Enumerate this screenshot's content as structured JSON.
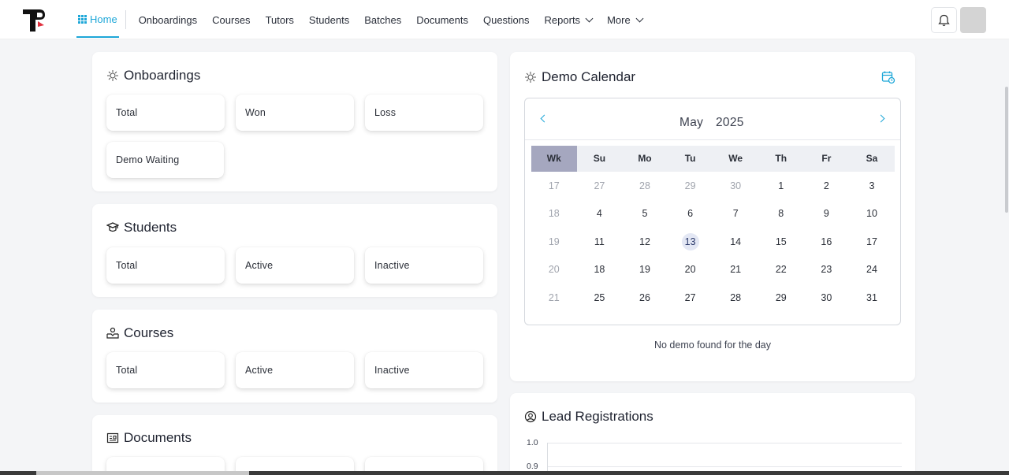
{
  "nav": {
    "home": "Home",
    "items": [
      "Onboardings",
      "Courses",
      "Tutors",
      "Students",
      "Batches",
      "Documents",
      "Questions"
    ],
    "reports": "Reports",
    "more": "More"
  },
  "onboardings": {
    "title": "Onboardings",
    "stats": [
      "Total",
      "Won",
      "Loss",
      "Demo Waiting"
    ]
  },
  "students": {
    "title": "Students",
    "stats": [
      "Total",
      "Active",
      "Inactive"
    ]
  },
  "courses": {
    "title": "Courses",
    "stats": [
      "Total",
      "Active",
      "Inactive"
    ]
  },
  "documents": {
    "title": "Documents"
  },
  "calendar": {
    "title": "Demo Calendar",
    "month": "May",
    "year": "2025",
    "dow": [
      "Wk",
      "Su",
      "Mo",
      "Tu",
      "We",
      "Th",
      "Fr",
      "Sa"
    ],
    "weeks": [
      [
        "17",
        "27",
        "28",
        "29",
        "30",
        "1",
        "2",
        "3"
      ],
      [
        "18",
        "4",
        "5",
        "6",
        "7",
        "8",
        "9",
        "10"
      ],
      [
        "19",
        "11",
        "12",
        "13",
        "14",
        "15",
        "16",
        "17"
      ],
      [
        "20",
        "18",
        "19",
        "20",
        "21",
        "22",
        "23",
        "24"
      ],
      [
        "21",
        "25",
        "26",
        "27",
        "28",
        "29",
        "30",
        "31"
      ]
    ],
    "today": "13",
    "empty_message": "No demo found for the day"
  },
  "lead_registrations": {
    "title": "Lead Registrations",
    "y_ticks": [
      "1.0",
      "0.9"
    ]
  },
  "colors": {
    "accent": "#1ea7d8",
    "week_header": "#a5a7bf"
  }
}
